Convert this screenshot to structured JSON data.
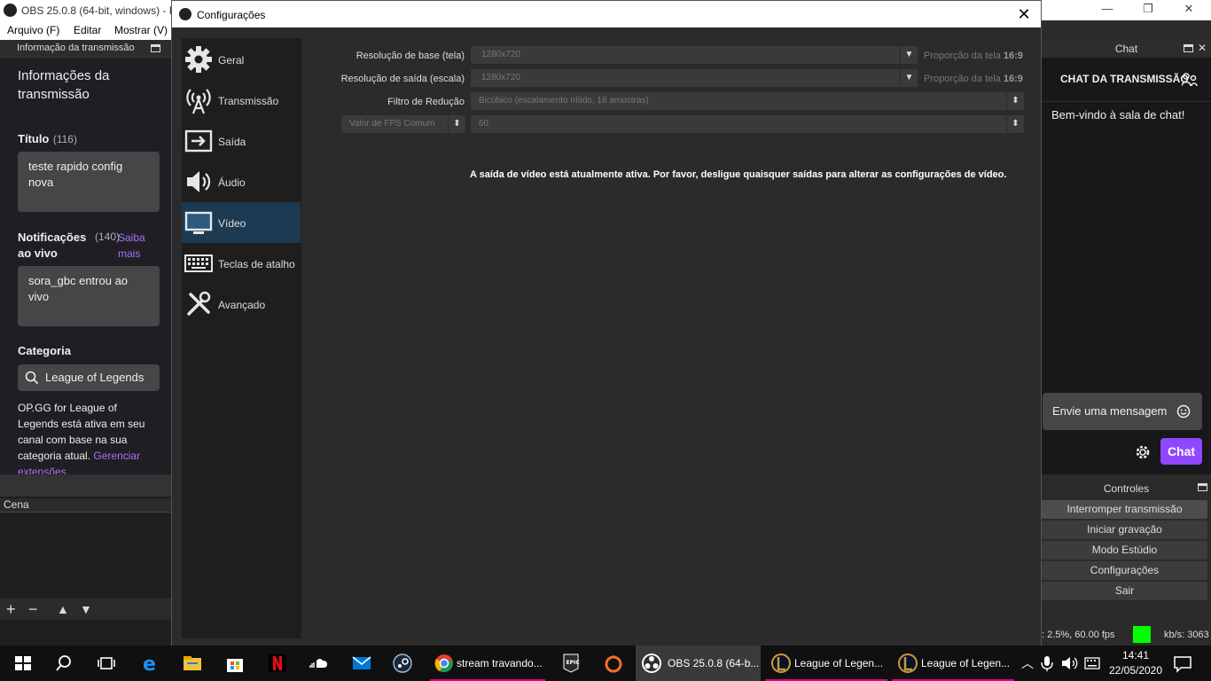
{
  "obs": {
    "window_title": "OBS 25.0.8 (64-bit, windows) - P",
    "menu": [
      "Arquivo (F)",
      "Editar",
      "Mostrar (V)"
    ]
  },
  "info_dock": {
    "header": "Informação da transmissão",
    "heading": "Informações da transmissão",
    "title_label": "Título",
    "title_count": "(116)",
    "title_value": "teste rapido config nova",
    "notif_label": "Notificações ao vivo",
    "notif_count": "(140)",
    "notif_link": "Saiba mais",
    "notif_value": "sora_gbc entrou ao vivo",
    "category_label": "Categoria",
    "category_value": "League of Legends",
    "extension_text": "OP.GG for League of Legends está ativa em seu canal com base na sua categoria atual.",
    "extension_link": "Gerenciar extensões"
  },
  "scenes": {
    "header": "Cena"
  },
  "chat": {
    "header": "Chat",
    "title": "CHAT DA TRANSMISSÃO",
    "welcome": "Bem-vindo à sala de chat!",
    "input_placeholder": "Envie uma mensagem",
    "button": "Chat"
  },
  "controls": {
    "header": "Controles",
    "buttons": [
      "Interromper transmissão",
      "Iniciar gravação",
      "Modo Estúdio",
      "Configurações",
      "Sair"
    ]
  },
  "status": {
    "cpu": ": 2.5%, 60.00 fps",
    "kbps": "kb/s: 3063",
    "indicator_color": "#00ff00"
  },
  "settings": {
    "title": "Configurações",
    "nav": [
      {
        "label": "Geral",
        "icon": "gear-icon"
      },
      {
        "label": "Transmissão",
        "icon": "antenna-icon"
      },
      {
        "label": "Saída",
        "icon": "output-icon"
      },
      {
        "label": "Áudio",
        "icon": "speaker-icon"
      },
      {
        "label": "Vídeo",
        "icon": "monitor-icon"
      },
      {
        "label": "Teclas de atalho",
        "icon": "keyboard-icon"
      },
      {
        "label": "Avançado",
        "icon": "tools-icon"
      }
    ],
    "active_nav": "Vídeo",
    "fields": {
      "base_res_label": "Resolução de base (tela)",
      "base_res_value": "1280x720",
      "base_aspect_label": "Proporção da tela",
      "base_aspect_value": "16:9",
      "out_res_label": "Resolução de saída (escala)",
      "out_res_value": "1280x720",
      "out_aspect_label": "Proporção da tela",
      "out_aspect_value": "16:9",
      "filter_label": "Filtro de Redução",
      "filter_value": "Bicúbico (escalamento nítido, 16 amostras)",
      "fps_type_value": "Valor de FPS Comum",
      "fps_value": "60"
    },
    "warning": "A saída de vídeo está atualmente ativa. Por favor, desligue quaisquer saídas para alterar as configurações de vídeo."
  },
  "taskbar": {
    "tasks": [
      {
        "label": "stream travando...",
        "icon": "chrome-icon"
      },
      {
        "label": "OBS 25.0.8 (64-b...",
        "icon": "obs-icon"
      },
      {
        "label": "League of Legen...",
        "icon": "lol-icon"
      },
      {
        "label": "League of Legen...",
        "icon": "lol-icon"
      }
    ],
    "time": "14:41",
    "date": "22/05/2020"
  }
}
